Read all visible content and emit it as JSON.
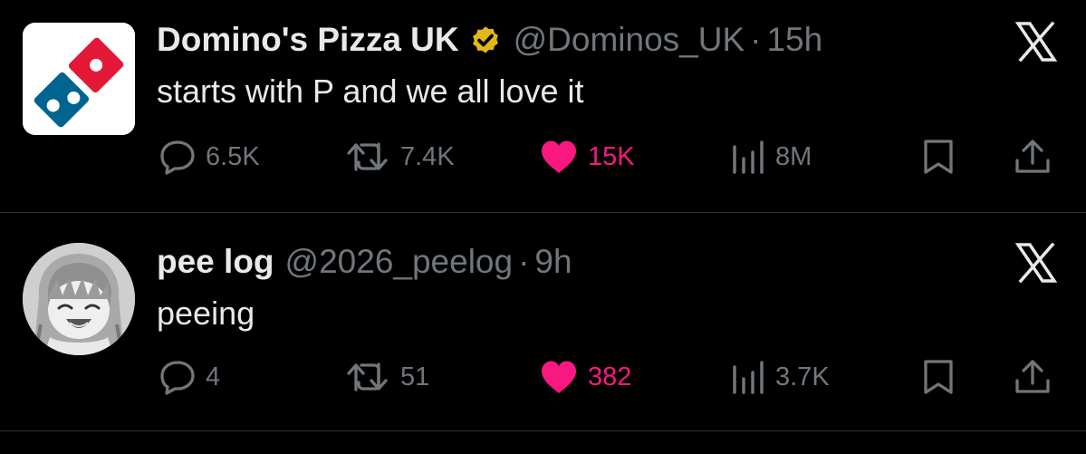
{
  "tweets": [
    {
      "display_name": "Domino's Pizza UK",
      "verified": true,
      "handle": "@Dominos_UK",
      "separator": "·",
      "time": "15h",
      "text": "starts with P and we all love it",
      "metrics": {
        "replies": "6.5K",
        "reposts": "7.4K",
        "likes": "15K",
        "views": "8M"
      },
      "liked": true,
      "avatar_icon": "dominos-logo-icon"
    },
    {
      "display_name": "pee log",
      "verified": false,
      "handle": "@2026_peelog",
      "separator": "·",
      "time": "9h",
      "text": "peeing",
      "metrics": {
        "replies": "4",
        "reposts": "51",
        "likes": "382",
        "views": "3.7K"
      },
      "liked": true,
      "avatar_icon": "anime-girl-avatar-icon"
    }
  ],
  "colors": {
    "background": "#000000",
    "text_primary": "#e7e9ea",
    "text_secondary": "#71767b",
    "like_accent": "#f91880",
    "divider": "#2f3336",
    "verified_badge": "#e2b719",
    "dominos_red": "#e31837",
    "dominos_blue": "#006491"
  },
  "icons": {
    "reply": "reply-icon",
    "repost": "repost-icon",
    "like": "heart-icon",
    "views": "views-chart-icon",
    "bookmark": "bookmark-icon",
    "share": "share-icon",
    "brand": "x-logo-icon",
    "verified": "verified-badge-icon"
  }
}
